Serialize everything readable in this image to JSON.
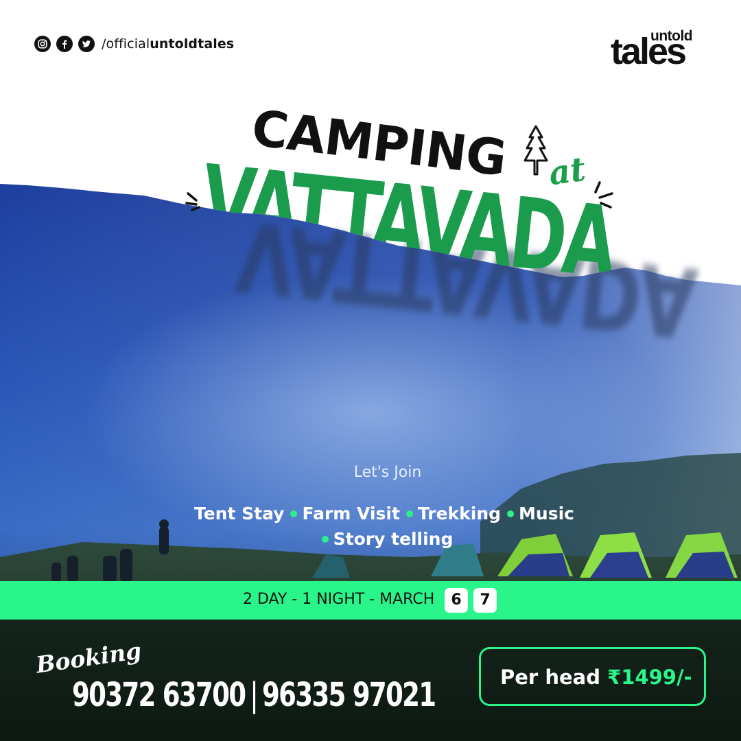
{
  "social": {
    "icons": [
      "instagram-icon",
      "facebook-icon",
      "twitter-icon"
    ],
    "handle_prefix": "/official",
    "handle_bold": "untoldtales"
  },
  "logo": {
    "top": "untold",
    "main": "tales"
  },
  "title": {
    "line1": "CAMPING",
    "connector": "at",
    "line2": "VATTAVADA"
  },
  "intro": "Let's Join",
  "features": [
    "Tent Stay",
    "Farm Visit",
    "Trekking",
    "Music",
    "Story telling"
  ],
  "schedule": {
    "text": "2 DAY - 1 NIGHT - MARCH",
    "days": [
      "6",
      "7"
    ]
  },
  "booking": {
    "label": "Booking",
    "phone1": "90372 63700",
    "separator": "|",
    "phone2": "96335 97021"
  },
  "price": {
    "label": "Per head",
    "value": "₹1499/-"
  },
  "colors": {
    "accent_green": "#2af58a",
    "title_green": "#1b9c4d",
    "sky_blue": "#1f4aa6",
    "text_dark": "#111111"
  }
}
